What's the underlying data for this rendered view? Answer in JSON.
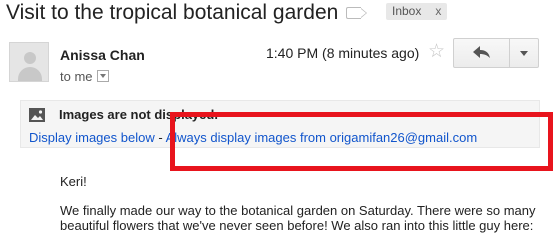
{
  "email": {
    "subject": "Visit to the tropical botanical garden",
    "label_chip": "Inbox",
    "label_chip_close": "x",
    "sender_name": "Anissa Chan",
    "recipient": "to me",
    "timestamp": "1:40 PM (8 minutes ago)"
  },
  "images_banner": {
    "title": "Images are not displayed.",
    "display_below_link": "Display images below",
    "separator": " - ",
    "always_display_link": "Always display images from origamifan26@gmail.com"
  },
  "message": {
    "greeting": "Keri!",
    "paragraph": "We finally made our way to the botanical garden on Saturday. There were so many beautiful flowers that we've never seen before! We also ran into this little guy here:"
  },
  "icons": {
    "star": "star-icon",
    "reply": "reply-icon",
    "more": "chevron-down-icon",
    "image": "image-icon",
    "label": "label-icon",
    "avatar": "avatar-icon"
  },
  "colors": {
    "link": "#1155cc",
    "highlight_border": "#e8141d",
    "banner_bg": "#f5f5f5"
  }
}
